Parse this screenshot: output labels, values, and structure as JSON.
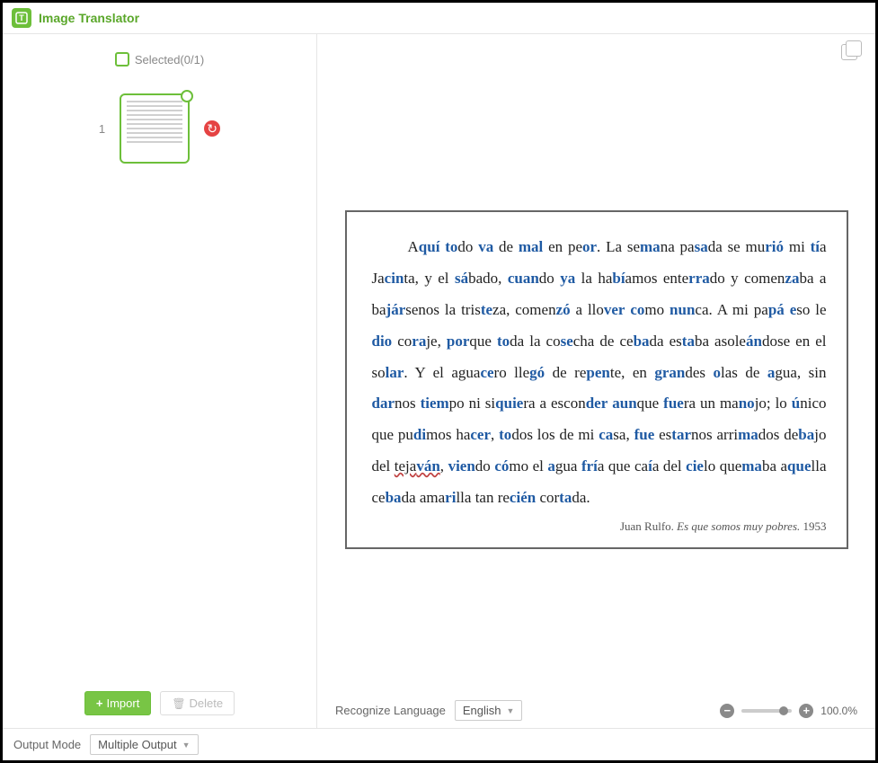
{
  "header": {
    "title": "Image Translator"
  },
  "sidebar": {
    "selected_label": "Selected(0/1)",
    "thumb_index": "1",
    "import_label": "Import",
    "delete_label": "Delete"
  },
  "content": {
    "recognize_language_label": "Recognize Language",
    "recognize_language_value": "English",
    "zoom_value": "100.0%"
  },
  "document": {
    "attribution_author": "Juan Rulfo.",
    "attribution_title": "Es que somos muy pobres.",
    "attribution_year": "1953",
    "spans": [
      {
        "t": "A",
        "b": false
      },
      {
        "t": "quí",
        "b": true
      },
      {
        "t": " ",
        "b": false
      },
      {
        "t": "to",
        "b": true
      },
      {
        "t": "do ",
        "b": false
      },
      {
        "t": "va",
        "b": true
      },
      {
        "t": " de ",
        "b": false
      },
      {
        "t": "mal",
        "b": true
      },
      {
        "t": " en pe",
        "b": false
      },
      {
        "t": "or",
        "b": true
      },
      {
        "t": ". La se",
        "b": false
      },
      {
        "t": "ma",
        "b": true
      },
      {
        "t": "na pa",
        "b": false
      },
      {
        "t": "sa",
        "b": true
      },
      {
        "t": "da se mu",
        "b": false
      },
      {
        "t": "rió",
        "b": true
      },
      {
        "t": " mi ",
        "b": false
      },
      {
        "t": "tí",
        "b": true
      },
      {
        "t": "a Ja",
        "b": false
      },
      {
        "t": "cin",
        "b": true
      },
      {
        "t": "ta, y el ",
        "b": false
      },
      {
        "t": "sá",
        "b": true
      },
      {
        "t": "bado, ",
        "b": false
      },
      {
        "t": "cuan",
        "b": true
      },
      {
        "t": "do ",
        "b": false
      },
      {
        "t": "ya",
        "b": true
      },
      {
        "t": " la ha",
        "b": false
      },
      {
        "t": "bí",
        "b": true
      },
      {
        "t": "amos ente",
        "b": false
      },
      {
        "t": "rra",
        "b": true
      },
      {
        "t": "do y comen",
        "b": false
      },
      {
        "t": "za",
        "b": true
      },
      {
        "t": "ba a ba",
        "b": false
      },
      {
        "t": "jár",
        "b": true
      },
      {
        "t": "senos la tris",
        "b": false
      },
      {
        "t": "te",
        "b": true
      },
      {
        "t": "za, comen",
        "b": false
      },
      {
        "t": "zó",
        "b": true
      },
      {
        "t": " a llo",
        "b": false
      },
      {
        "t": "ver",
        "b": true
      },
      {
        "t": " ",
        "b": false
      },
      {
        "t": "co",
        "b": true
      },
      {
        "t": "mo ",
        "b": false
      },
      {
        "t": "nun",
        "b": true
      },
      {
        "t": "ca. A mi pa",
        "b": false
      },
      {
        "t": "pá",
        "b": true
      },
      {
        "t": " ",
        "b": false
      },
      {
        "t": "e",
        "b": true
      },
      {
        "t": "so le ",
        "b": false
      },
      {
        "t": "dio",
        "b": true
      },
      {
        "t": " co",
        "b": false
      },
      {
        "t": "ra",
        "b": true
      },
      {
        "t": "je, ",
        "b": false
      },
      {
        "t": "por",
        "b": true
      },
      {
        "t": "que ",
        "b": false
      },
      {
        "t": "to",
        "b": true
      },
      {
        "t": "da la co",
        "b": false
      },
      {
        "t": "se",
        "b": true
      },
      {
        "t": "cha de ce",
        "b": false
      },
      {
        "t": "ba",
        "b": true
      },
      {
        "t": "da es",
        "b": false
      },
      {
        "t": "ta",
        "b": true
      },
      {
        "t": "ba asole",
        "b": false
      },
      {
        "t": "án",
        "b": true
      },
      {
        "t": "dose en el so",
        "b": false
      },
      {
        "t": "lar",
        "b": true
      },
      {
        "t": ". Y el agua",
        "b": false
      },
      {
        "t": "ce",
        "b": true
      },
      {
        "t": "ro lle",
        "b": false
      },
      {
        "t": "gó",
        "b": true
      },
      {
        "t": " de re",
        "b": false
      },
      {
        "t": "pen",
        "b": true
      },
      {
        "t": "te, en ",
        "b": false
      },
      {
        "t": "gran",
        "b": true
      },
      {
        "t": "des ",
        "b": false
      },
      {
        "t": "o",
        "b": true
      },
      {
        "t": "las de ",
        "b": false
      },
      {
        "t": "a",
        "b": true
      },
      {
        "t": "gua, sin ",
        "b": false
      },
      {
        "t": "dar",
        "b": true
      },
      {
        "t": "nos ",
        "b": false
      },
      {
        "t": "tiem",
        "b": true
      },
      {
        "t": "po ni si",
        "b": false
      },
      {
        "t": "quie",
        "b": true
      },
      {
        "t": "ra a escon",
        "b": false
      },
      {
        "t": "der",
        "b": true
      },
      {
        "t": " ",
        "b": false
      },
      {
        "t": "aun",
        "b": true
      },
      {
        "t": "que ",
        "b": false
      },
      {
        "t": "fue",
        "b": true
      },
      {
        "t": "ra un ma",
        "b": false
      },
      {
        "t": "no",
        "b": true
      },
      {
        "t": "jo; lo ",
        "b": false
      },
      {
        "t": "ú",
        "b": true
      },
      {
        "t": "nico que pu",
        "b": false
      },
      {
        "t": "di",
        "b": true
      },
      {
        "t": "mos ha",
        "b": false
      },
      {
        "t": "cer",
        "b": true
      },
      {
        "t": ", ",
        "b": false
      },
      {
        "t": "to",
        "b": true
      },
      {
        "t": "dos los de mi ",
        "b": false
      },
      {
        "t": "ca",
        "b": true
      },
      {
        "t": "sa, ",
        "b": false
      },
      {
        "t": "fue",
        "b": true
      },
      {
        "t": " es",
        "b": false
      },
      {
        "t": "tar",
        "b": true
      },
      {
        "t": "nos arri",
        "b": false
      },
      {
        "t": "ma",
        "b": true
      },
      {
        "t": "dos de",
        "b": false
      },
      {
        "t": "ba",
        "b": true
      },
      {
        "t": "jo del ",
        "b": false
      },
      {
        "t": "teja",
        "b": false,
        "u": true
      },
      {
        "t": "ván",
        "b": true,
        "u": true
      },
      {
        "t": ", ",
        "b": false
      },
      {
        "t": "vien",
        "b": true
      },
      {
        "t": "do ",
        "b": false
      },
      {
        "t": "có",
        "b": true
      },
      {
        "t": "mo el ",
        "b": false
      },
      {
        "t": "a",
        "b": true
      },
      {
        "t": "gua ",
        "b": false
      },
      {
        "t": "frí",
        "b": true
      },
      {
        "t": "a que ca",
        "b": false
      },
      {
        "t": "í",
        "b": true
      },
      {
        "t": "a del ",
        "b": false
      },
      {
        "t": "cie",
        "b": true
      },
      {
        "t": "lo que",
        "b": false
      },
      {
        "t": "ma",
        "b": true
      },
      {
        "t": "ba a",
        "b": false
      },
      {
        "t": "que",
        "b": true
      },
      {
        "t": "lla ce",
        "b": false
      },
      {
        "t": "ba",
        "b": true
      },
      {
        "t": "da ama",
        "b": false
      },
      {
        "t": "ri",
        "b": true
      },
      {
        "t": "lla tan re",
        "b": false
      },
      {
        "t": "cién",
        "b": true
      },
      {
        "t": " cor",
        "b": false
      },
      {
        "t": "ta",
        "b": true
      },
      {
        "t": "da.",
        "b": false
      }
    ]
  },
  "bottombar": {
    "output_mode_label": "Output Mode",
    "output_mode_value": "Multiple Output"
  }
}
